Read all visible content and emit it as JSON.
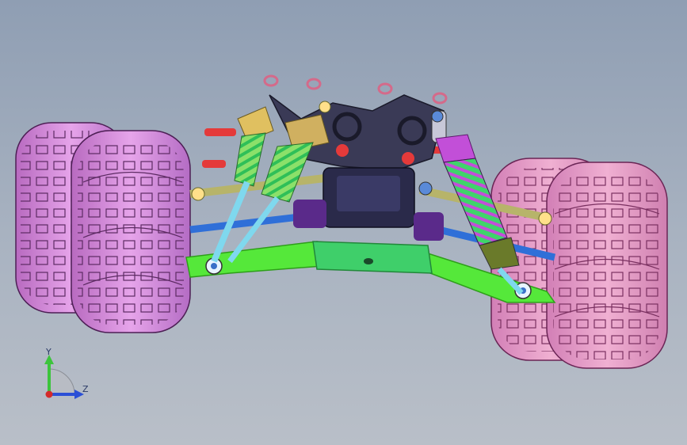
{
  "viewport": {
    "background_top": "#8f9eb3",
    "background_bottom": "#b9bfc8"
  },
  "model": {
    "subject": "rc-monster-truck-chassis-assembly",
    "colors": {
      "tire": "#d98bdc",
      "tire_front": "#e6a0c4",
      "arm": "#55e83a",
      "arm_dark": "#2e9e1a",
      "spring_green": "#3fd46a",
      "spring_purple": "#c24fd8",
      "shock_body": "#9be060",
      "link_rod": "#2f6fd8",
      "gearbox": "#2a2a4a",
      "mount_purple": "#5a2a8a",
      "rod_end": "#ffe08a",
      "red_part": "#e43a3a",
      "olive_tube": "#b7b46a"
    }
  },
  "triad": {
    "y_label": "Y",
    "z_label": "Z",
    "y_color": "#3cc43c",
    "z_color": "#2b4fd6",
    "x_color": "#d42a2a"
  }
}
